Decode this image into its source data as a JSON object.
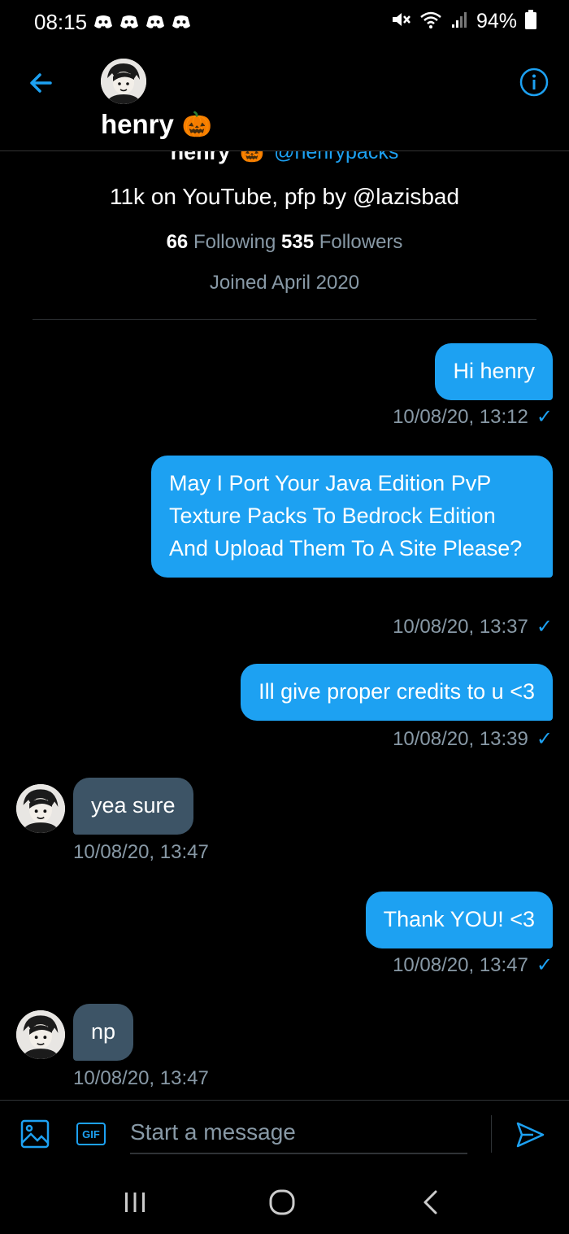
{
  "status_bar": {
    "time": "08:15",
    "battery": "94%",
    "notification_icons": [
      "discord-icon",
      "discord-icon",
      "discord-icon",
      "discord-icon"
    ]
  },
  "header": {
    "name": "henry",
    "emoji": "🎃"
  },
  "profile": {
    "name": "henry",
    "emoji": "🎃",
    "handle": "@henrypacks",
    "bio": "11k on YouTube, pfp by @lazisbad",
    "following_count": "66",
    "following_label": "Following",
    "followers_count": "535",
    "followers_label": "Followers",
    "joined": "Joined April 2020"
  },
  "messages": [
    {
      "direction": "out",
      "text": "Hi henry",
      "time": "10/08/20, 13:12"
    },
    {
      "direction": "out",
      "text": "May I Port Your Java Edition PvP Texture Packs To Bedrock Edition And Upload Them To A Site Please?",
      "time": "10/08/20, 13:37"
    },
    {
      "direction": "out",
      "text": "Ill give proper credits to u <3",
      "time": "10/08/20, 13:39"
    },
    {
      "direction": "in",
      "text": "yea sure",
      "time": "10/08/20, 13:47"
    },
    {
      "direction": "out",
      "text": "Thank YOU! <3",
      "time": "10/08/20, 13:47"
    },
    {
      "direction": "in",
      "text": "np",
      "time": "10/08/20, 13:47"
    }
  ],
  "composer": {
    "placeholder": "Start a message",
    "gif_label": "GIF"
  },
  "colors": {
    "accent": "#1da1f2",
    "incoming_bubble": "#3d5466",
    "muted_text": "#8899a6",
    "background": "#000000"
  }
}
